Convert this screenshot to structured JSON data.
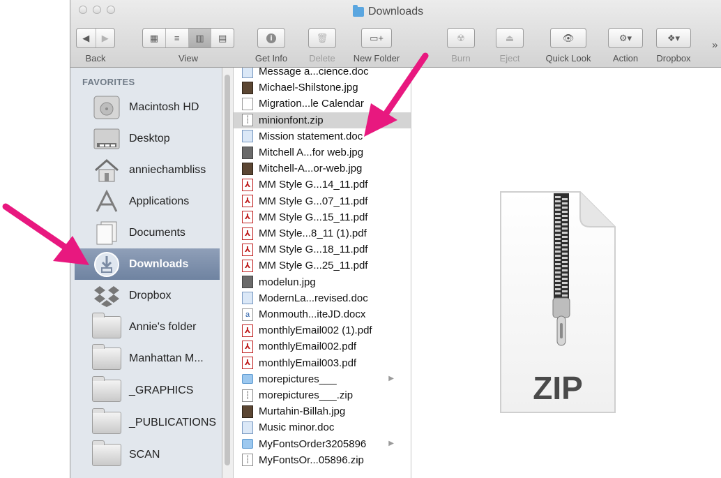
{
  "window": {
    "title": "Downloads",
    "folder_icon": "folder-icon"
  },
  "toolbar": {
    "back": {
      "label": "Back",
      "icon_left": "◀",
      "icon_right": "▶"
    },
    "view": {
      "label": "View",
      "modes": [
        "▦",
        "≡",
        "▥",
        "▤"
      ],
      "active_index": 2
    },
    "get_info": {
      "label": "Get Info",
      "icon": "i"
    },
    "delete": {
      "label": "Delete",
      "icon": "🗑"
    },
    "new_folder": {
      "label": "New Folder",
      "icon": "▭+"
    },
    "burn": {
      "label": "Burn",
      "icon": "☢"
    },
    "eject": {
      "label": "Eject",
      "icon": "⏏"
    },
    "quick_look": {
      "label": "Quick Look",
      "icon": "👁"
    },
    "action": {
      "label": "Action",
      "icon": "⚙▾"
    },
    "dropbox": {
      "label": "Dropbox",
      "icon": "❖▾"
    },
    "overflow": "»"
  },
  "sidebar": {
    "header": "FAVORITES",
    "items": [
      {
        "label": "Macintosh HD",
        "icon": "hard-drive-icon"
      },
      {
        "label": "Desktop",
        "icon": "desktop-icon"
      },
      {
        "label": "anniechambliss",
        "icon": "home-icon"
      },
      {
        "label": "Applications",
        "icon": "applications-icon"
      },
      {
        "label": "Documents",
        "icon": "documents-icon"
      },
      {
        "label": "Downloads",
        "icon": "downloads-icon",
        "selected": true
      },
      {
        "label": "Dropbox",
        "icon": "dropbox-icon"
      },
      {
        "label": "Annie's folder",
        "icon": "folder-icon"
      },
      {
        "label": "Manhattan M...",
        "icon": "folder-icon"
      },
      {
        "label": "_GRAPHICS",
        "icon": "folder-icon"
      },
      {
        "label": "_PUBLICATIONS",
        "icon": "folder-icon"
      },
      {
        "label": "SCAN",
        "icon": "folder-icon"
      }
    ]
  },
  "files": [
    {
      "name": "Message a...cience.doc",
      "type": "doc"
    },
    {
      "name": "Michael-Shilstone.jpg",
      "type": "photo"
    },
    {
      "name": "Migration...le Calendar",
      "type": "blank"
    },
    {
      "name": "minionfont.zip",
      "type": "zip",
      "selected": true
    },
    {
      "name": "Mission statement.doc",
      "type": "doc"
    },
    {
      "name": "Mitchell A...for web.jpg",
      "type": "img"
    },
    {
      "name": "Mitchell-A...or-web.jpg",
      "type": "photo"
    },
    {
      "name": "MM Style G...14_11.pdf",
      "type": "pdf"
    },
    {
      "name": "MM Style G...07_11.pdf",
      "type": "pdf"
    },
    {
      "name": "MM Style G...15_11.pdf",
      "type": "pdf"
    },
    {
      "name": "MM Style...8_11 (1).pdf",
      "type": "pdf"
    },
    {
      "name": "MM Style G...18_11.pdf",
      "type": "pdf"
    },
    {
      "name": "MM Style G...25_11.pdf",
      "type": "pdf"
    },
    {
      "name": "modelun.jpg",
      "type": "img"
    },
    {
      "name": "ModernLa...revised.doc",
      "type": "doc"
    },
    {
      "name": "Monmouth...iteJD.docx",
      "type": "docx"
    },
    {
      "name": "monthlyEmail002 (1).pdf",
      "type": "pdf"
    },
    {
      "name": "monthlyEmail002.pdf",
      "type": "pdf"
    },
    {
      "name": "monthlyEmail003.pdf",
      "type": "pdf"
    },
    {
      "name": "morepictures___",
      "type": "dir",
      "expandable": true
    },
    {
      "name": "morepictures___.zip",
      "type": "zip"
    },
    {
      "name": "Murtahin-Billah.jpg",
      "type": "photo"
    },
    {
      "name": "Music minor.doc",
      "type": "doc"
    },
    {
      "name": "MyFontsOrder3205896",
      "type": "dir",
      "expandable": true
    },
    {
      "name": "MyFontsOr...05896.zip",
      "type": "zip"
    }
  ],
  "preview": {
    "badge": "ZIP",
    "icon": "zip-archive-icon"
  },
  "colors": {
    "arrow": "#e8187f",
    "selection": "#7486a4",
    "sidebar_bg": "#e2e7ed"
  }
}
